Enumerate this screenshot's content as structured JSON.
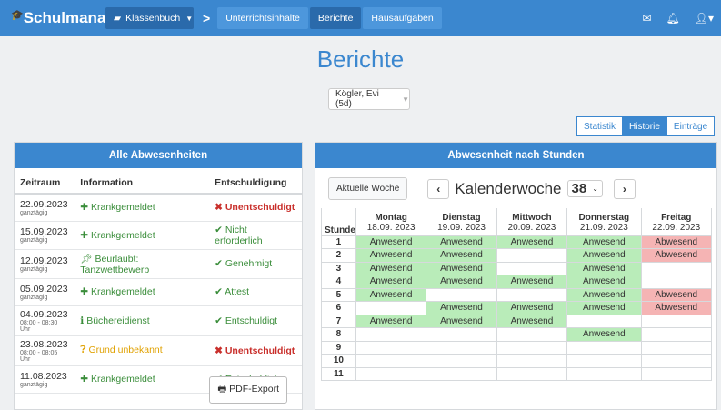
{
  "nav": {
    "brand": "Schulmanager",
    "classbook": "Klassenbuch",
    "separator": ">",
    "tabs": [
      "Unterrichtsinhalte",
      "Berichte",
      "Hausaufgaben"
    ],
    "active_tab": "Berichte",
    "icons": [
      "mail-icon",
      "bell-icon",
      "user-icon"
    ]
  },
  "page": {
    "title": "Berichte",
    "student": "Kögler, Evi (5d)",
    "views": [
      "Statistik",
      "Historie",
      "Einträge"
    ],
    "active_view": "Historie"
  },
  "absences": {
    "heading": "Alle Abwesenheiten",
    "columns": [
      "Zeitraum",
      "Information",
      "Entschuldigung"
    ],
    "rows": [
      {
        "date": "22.09.2023",
        "sub": "ganztägig",
        "info": "Krankgemeldet",
        "info_icon": "medical-icon",
        "status": "Unentschuldigt",
        "status_type": "red"
      },
      {
        "date": "15.09.2023",
        "sub": "ganztägig",
        "info": "Krankgemeldet",
        "info_icon": "medical-icon",
        "status": "Nicht erforderlich",
        "status_type": "green"
      },
      {
        "date": "12.09.2023",
        "sub": "ganztägig",
        "info": "Beurlaubt: Tanzwettbewerb",
        "info_icon": "pin-icon",
        "status": "Genehmigt",
        "status_type": "green"
      },
      {
        "date": "05.09.2023",
        "sub": "ganztägig",
        "info": "Krankgemeldet",
        "info_icon": "medical-icon",
        "status": "Attest",
        "status_type": "green"
      },
      {
        "date": "04.09.2023",
        "sub": "08:00 - 08:30 Uhr",
        "info": "Büchereidienst",
        "info_icon": "info-icon",
        "status": "Entschuldigt",
        "status_type": "green"
      },
      {
        "date": "23.08.2023",
        "sub": "08:00 - 08:05 Uhr",
        "info": "Grund unbekannt",
        "info_icon": "question-icon",
        "status": "Unentschuldigt",
        "status_type": "red"
      },
      {
        "date": "11.08.2023",
        "sub": "ganztägig",
        "info": "Krankgemeldet",
        "info_icon": "medical-icon",
        "status": "Entschuldigt",
        "status_type": "green"
      }
    ],
    "pdf_button": "PDF-Export"
  },
  "hours": {
    "heading": "Abwesenheit nach Stunden",
    "current_week_button": "Aktuelle Woche",
    "week_label": "Kalenderwoche",
    "week_number": "38",
    "stunde_label": "Stunde",
    "days": [
      {
        "name": "Montag",
        "date": "18.09. 2023"
      },
      {
        "name": "Dienstag",
        "date": "19.09. 2023"
      },
      {
        "name": "Mittwoch",
        "date": "20.09. 2023"
      },
      {
        "name": "Donnerstag",
        "date": "21.09. 2023"
      },
      {
        "name": "Freitag",
        "date": "22.09. 2023"
      }
    ],
    "grid": [
      [
        "Anwesend",
        "Anwesend",
        "Anwesend",
        "Anwesend",
        "Abwesend"
      ],
      [
        "Anwesend",
        "Anwesend",
        "",
        "Anwesend",
        "Abwesend"
      ],
      [
        "Anwesend",
        "Anwesend",
        "",
        "Anwesend",
        ""
      ],
      [
        "Anwesend",
        "Anwesend",
        "Anwesend",
        "Anwesend",
        ""
      ],
      [
        "Anwesend",
        "",
        "",
        "Anwesend",
        "Abwesend"
      ],
      [
        "",
        "Anwesend",
        "Anwesend",
        "Anwesend",
        "Abwesend"
      ],
      [
        "Anwesend",
        "Anwesend",
        "Anwesend",
        "",
        ""
      ],
      [
        "",
        "",
        "",
        "Anwesend",
        ""
      ],
      [
        "",
        "",
        "",
        "",
        ""
      ],
      [
        "",
        "",
        "",
        "",
        ""
      ],
      [
        "",
        "",
        "",
        "",
        ""
      ]
    ],
    "colors": {
      "present": "#b9ecb9",
      "absent": "#f5b4b4"
    }
  }
}
